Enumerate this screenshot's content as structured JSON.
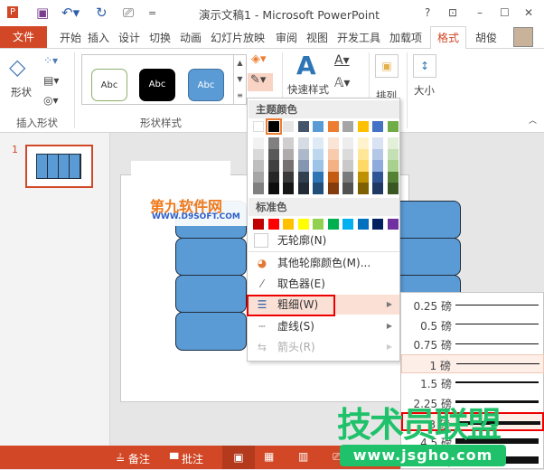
{
  "titlebar": {
    "title": "演示文稿1 - Microsoft PowerPoint",
    "help": "?",
    "min": "–",
    "max": "☐",
    "close": "✕"
  },
  "tabs": {
    "file": "文件",
    "items": [
      "开始",
      "插入",
      "设计",
      "切换",
      "动画",
      "幻灯片放映",
      "审阅",
      "视图",
      "开发工具",
      "加载项"
    ],
    "active": "格式",
    "user": "胡俊"
  },
  "ribbon": {
    "shapes_label": "形状",
    "insert_group": "插入形状",
    "style_group": "形状样式",
    "abc": [
      "Abc",
      "Abc",
      "Abc"
    ],
    "quick_styles": "快速样式",
    "arrange": "排列",
    "size": "大小"
  },
  "slide_panel": {
    "number": "1"
  },
  "watermark": {
    "cn": "第九软件网",
    "url": "WWW.D9SOFT.COM",
    "cn2": "技术员联盟",
    "url2": "www.jsgho.com"
  },
  "menu": {
    "theme_header": "主题颜色",
    "theme_colors": [
      "#ffffff",
      "#000000",
      "#e7e6e6",
      "#44546a",
      "#5b9bd5",
      "#ed7d31",
      "#a5a5a5",
      "#ffc000",
      "#4472c4",
      "#70ad47"
    ],
    "theme_shades": [
      [
        "#f2f2f2",
        "#d9d9d9",
        "#bfbfbf",
        "#a6a6a6",
        "#808080"
      ],
      [
        "#808080",
        "#595959",
        "#404040",
        "#262626",
        "#0d0d0d"
      ],
      [
        "#d0cece",
        "#afabab",
        "#767171",
        "#3a3838",
        "#171616"
      ],
      [
        "#d6dce4",
        "#adb9ca",
        "#8496b0",
        "#323f4f",
        "#222a35"
      ],
      [
        "#deebf7",
        "#bdd7ee",
        "#9dc3e6",
        "#2e75b6",
        "#1f4e79"
      ],
      [
        "#fbe5d6",
        "#f8cbad",
        "#f4b183",
        "#c55a11",
        "#843c0c"
      ],
      [
        "#ededed",
        "#dbdbdb",
        "#c9c9c9",
        "#7b7b7b",
        "#525252"
      ],
      [
        "#fff2cc",
        "#ffe699",
        "#ffd966",
        "#bf9000",
        "#7f6000"
      ],
      [
        "#dae3f3",
        "#b4c7e7",
        "#8faadc",
        "#2f5597",
        "#203864"
      ],
      [
        "#e2f0d9",
        "#c5e0b4",
        "#a9d18e",
        "#548235",
        "#385723"
      ]
    ],
    "standard_header": "标准色",
    "standard_colors": [
      "#c00000",
      "#ff0000",
      "#ffc000",
      "#ffff00",
      "#92d050",
      "#00b050",
      "#00b0f0",
      "#0070c0",
      "#002060",
      "#7030a0"
    ],
    "no_outline": "无轮廓(N)",
    "more_colors": "其他轮廓颜色(M)...",
    "eyedropper": "取色器(E)",
    "weight": "粗细(W)",
    "dashes": "虚线(S)",
    "arrows": "箭头(R)"
  },
  "weights": [
    {
      "label": "0.25 磅",
      "pt": 0.25
    },
    {
      "label": "0.5 磅",
      "pt": 0.5
    },
    {
      "label": "0.75 磅",
      "pt": 0.75
    },
    {
      "label": "1 磅",
      "pt": 1
    },
    {
      "label": "1.5 磅",
      "pt": 1.5
    },
    {
      "label": "2.25 磅",
      "pt": 2.25
    },
    {
      "label": "3 磅",
      "pt": 3
    },
    {
      "label": "4.5 磅",
      "pt": 4.5
    },
    {
      "label": "6 磅",
      "pt": 6
    }
  ],
  "status": {
    "notes": "备注",
    "comments": "批注"
  }
}
